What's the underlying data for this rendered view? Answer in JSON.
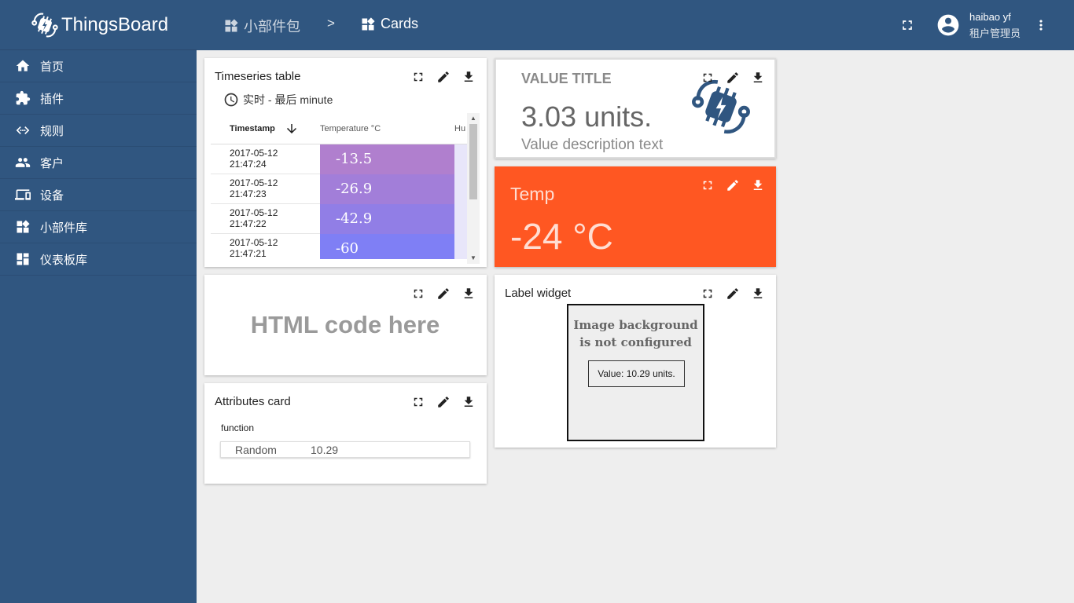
{
  "brand": {
    "name": "ThingsBoard"
  },
  "sidebar": {
    "items": [
      {
        "label": "首页",
        "icon": "home-icon"
      },
      {
        "label": "插件",
        "icon": "puzzle-icon"
      },
      {
        "label": "规则",
        "icon": "code-arrows-icon"
      },
      {
        "label": "客户",
        "icon": "people-icon"
      },
      {
        "label": "设备",
        "icon": "devices-icon"
      },
      {
        "label": "小部件库",
        "icon": "widgets-icon"
      },
      {
        "label": "仪表板库",
        "icon": "dashboard-icon"
      }
    ]
  },
  "header": {
    "breadcrumb": {
      "parent": "小部件包",
      "separator": ">",
      "current": "Cards"
    },
    "user": {
      "name": "haibao yf",
      "role": "租户管理员"
    }
  },
  "widgets": {
    "timeseries": {
      "title": "Timeseries table",
      "timewindow": "实时 - 最后 minute",
      "columns": {
        "timestamp": "Timestamp",
        "temperature": "Temperature °C",
        "humidity": "Hu"
      },
      "rows": [
        {
          "date": "2017-05-12",
          "time": "21:47:24",
          "value": "-13.5",
          "color": "#b07fce"
        },
        {
          "date": "2017-05-12",
          "time": "21:47:23",
          "value": "-26.9",
          "color": "#a27ed9"
        },
        {
          "date": "2017-05-12",
          "time": "21:47:22",
          "value": "-42.9",
          "color": "#917ee6"
        },
        {
          "date": "2017-05-12",
          "time": "21:47:21",
          "value": "-60",
          "color": "#7f7ff5"
        }
      ]
    },
    "value_card": {
      "title": "VALUE TITLE",
      "value": "3.03 units.",
      "description": "Value description text"
    },
    "temp_card": {
      "title": "Temp",
      "value": "-24 °C",
      "color": "#ff5722"
    },
    "html_card": {
      "text": "HTML code here"
    },
    "attributes": {
      "title": "Attributes card",
      "key": "function",
      "name": "Random",
      "value": "10.29"
    },
    "label_widget": {
      "title": "Label widget",
      "message_line1": "Image background",
      "message_line2": "is not configured",
      "value_label": "Value: 10.29 units."
    }
  },
  "colors": {
    "primary": "#305680",
    "accent": "#ff5722",
    "background": "#eeeeee"
  }
}
